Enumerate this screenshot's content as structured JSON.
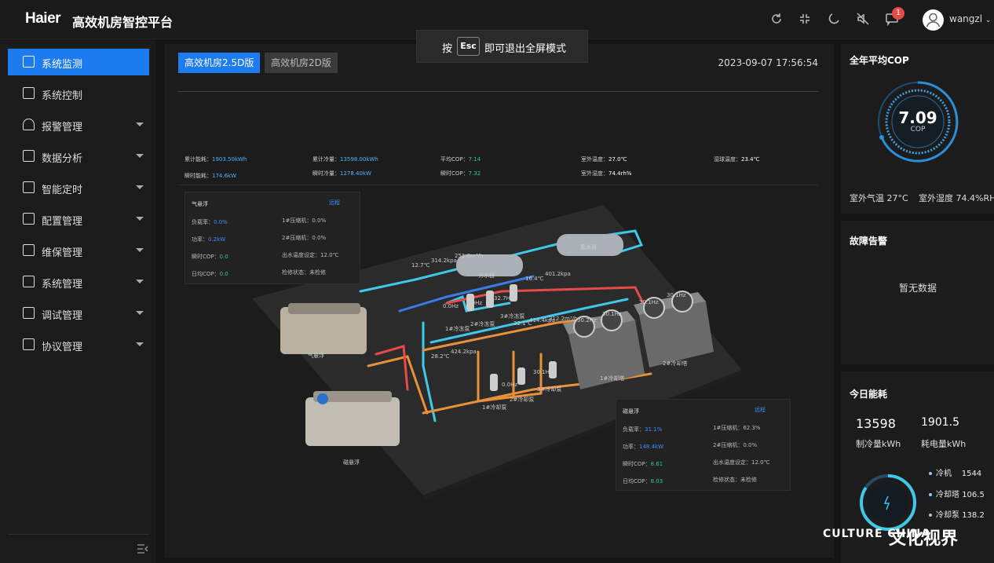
{
  "header": {
    "logo": "Haier",
    "title": "高效机房智控平台",
    "notification_count": "1",
    "username": "wangzl"
  },
  "fullscreen_tip": {
    "press": "按",
    "key": "Esc",
    "text": "即可退出全屏模式"
  },
  "sidebar": {
    "items": [
      {
        "label": "系统监测",
        "active": true
      },
      {
        "label": "系统控制"
      },
      {
        "label": "报警管理"
      },
      {
        "label": "数据分析"
      },
      {
        "label": "智能定时"
      },
      {
        "label": "配置管理"
      },
      {
        "label": "维保管理"
      },
      {
        "label": "系统管理"
      },
      {
        "label": "调试管理"
      },
      {
        "label": "协议管理"
      }
    ]
  },
  "main": {
    "tabs": [
      "高效机房2.5D版",
      "高效机房2D版"
    ],
    "datetime": "2023-09-07 17:56:54",
    "stats": {
      "total_energy_label": "累计能耗：",
      "total_energy": "1903.50kWh",
      "instant_energy_label": "瞬时能耗：",
      "instant_energy": "174.6kW",
      "total_cooling_label": "累计冷量：",
      "total_cooling": "13598.00kWh",
      "instant_cooling_label": "瞬时冷量：",
      "instant_cooling": "1278.40kW",
      "avg_cop_label": "平均COP：",
      "avg_cop": "7.14",
      "instant_cop_label": "瞬时COP：",
      "instant_cop": "7.32",
      "outdoor_temp_label": "室外温度：",
      "outdoor_temp": "27.0℃",
      "outdoor_humidity_label": "室外湿度：",
      "outdoor_humidity": "74.4rh%",
      "wet_bulb_label": "湿球温度：",
      "wet_bulb": "23.4℃"
    },
    "card_a": {
      "name": "气悬浮",
      "link": "远程",
      "load_label": "负载率：",
      "load": "0.0%",
      "power_label": "功率：",
      "power": "0.2kW",
      "inst_cop_label": "瞬时COP：",
      "inst_cop": "0.0",
      "day_cop_label": "日均COP：",
      "day_cop": "0.0",
      "comp1_label": "1#压缩机：",
      "comp1": "0.0%",
      "comp2_label": "2#压缩机：",
      "comp2": "0.0%",
      "water_label": "出水温度设定：",
      "water": "12.0℃",
      "maint_label": "检修状态：",
      "maint": "未检修"
    },
    "card_b": {
      "name": "磁悬浮",
      "link": "远程",
      "load_label": "负载率：",
      "load": "31.1%",
      "power_label": "功率：",
      "power": "148.4kW",
      "inst_cop_label": "瞬时COP：",
      "inst_cop": "8.61",
      "day_cop_label": "日均COP：",
      "day_cop": "8.03",
      "comp1_label": "1#压缩机：",
      "comp1": "62.3%",
      "comp2_label": "2#压缩机：",
      "comp2": "0.0%",
      "water_label": "出水温度设定：",
      "water": "12.0℃",
      "maint_label": "检修状态：",
      "maint": "未检修"
    },
    "diagram_labels": {
      "chiller_a": "气悬浮",
      "chiller_b": "磁悬浮",
      "header_1": "分水器",
      "header_2": "集水器",
      "supply_temp": "12.7℃",
      "supply_pressure": "314.2kpa",
      "supply_flow": "251.0m³/h",
      "return_temp": "16.4℃",
      "return_pressure": "401.2kpa",
      "tower_freq_1": "30.2Hz",
      "tower_freq_2": "30.1Hz",
      "tower_freq_3": "30.1Hz",
      "tower_freq_4": "30.1Hz",
      "tower_1": "1#冷却塔",
      "tower_2": "2#冷却塔",
      "pump_cold_1": "1#冷冻泵",
      "pump_cold_2": "2#冷冻泵",
      "pump_cold_3": "3#冷冻泵",
      "pump_cool_1": "1#冷却泵",
      "pump_cool_2": "2#冷却泵",
      "pump_cool_3": "3#冷却泵",
      "freq_0": "0.0Hz",
      "freq_a": "32.7Hz",
      "freq_b": "30.1Hz",
      "cw_temp": "28.2℃",
      "cw_pressure": "424.2kpa",
      "cw_temp2": "32.1℃",
      "cw_pressure2": "414.4kpa",
      "cw_flow": "312.2m³/h"
    }
  },
  "right": {
    "cop_title": "全年平均COP",
    "cop_value": "7.09",
    "cop_unit": "COP",
    "outdoor_temp": "室外气温 27°C",
    "outdoor_humidity": "室外湿度 74.4%RH",
    "fault_title": "故障告警",
    "fault_empty": "暂无数据",
    "energy_title": "今日能耗",
    "cooling_value": "13598",
    "cooling_label": "制冷量kWh",
    "power_value": "1901.5",
    "power_label": "耗电量kWh",
    "breakdown": [
      {
        "name": "冷机",
        "value": "1544"
      },
      {
        "name": "冷却塔",
        "value": "106.5"
      },
      {
        "name": "冷却泵",
        "value": "138.2"
      }
    ]
  },
  "watermark": {
    "latin": "CULTURE CHINA",
    "cn": "文化视界"
  },
  "colors": {
    "accent": "#1d7bf0",
    "cyan": "#3fc8e8",
    "orange": "#e8913a",
    "red": "#e84a4a",
    "green": "#36c98a"
  }
}
